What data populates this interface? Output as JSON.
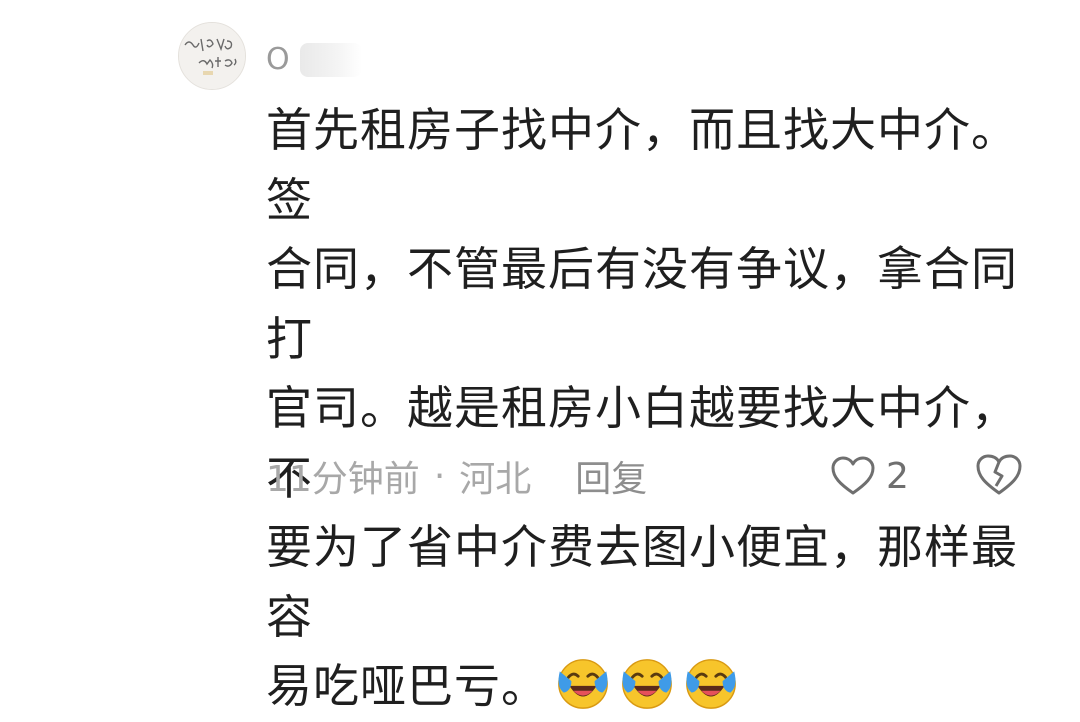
{
  "comment": {
    "username": "O",
    "avatar_text": "打开吗 谁的？",
    "lines": [
      "首先租房子找中介，而且找大中介。签",
      "合同，不管最后有没有争议，拿合同打",
      "官司。越是租房小白越要找大中介，不",
      "要为了省中介费去图小便宜，那样最容",
      "易吃哑巴亏。"
    ],
    "emojis": [
      "laughing-crying-emoji",
      "laughing-crying-emoji",
      "laughing-crying-emoji"
    ],
    "time": "11分钟前",
    "separator": "·",
    "location": "河北",
    "reply_label": "回复",
    "like_count": "2"
  },
  "icons": {
    "like": "heart-outline-icon",
    "dislike": "broken-heart-icon"
  },
  "colors": {
    "text": "#1f1f1f",
    "meta": "#a8a8a8",
    "emoji_face": "#f7c52b",
    "emoji_tear": "#3f9be8"
  }
}
